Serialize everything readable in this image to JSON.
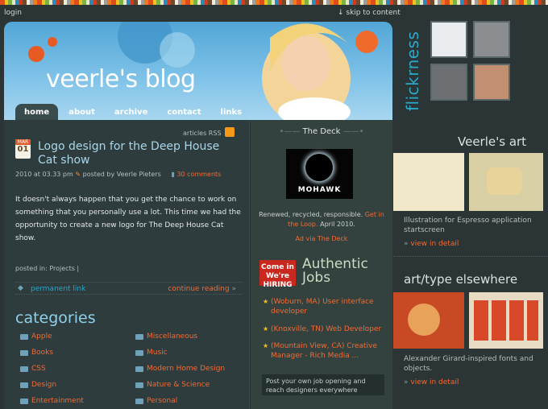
{
  "top": {
    "login": "login",
    "skip": "skip to content"
  },
  "header": {
    "title": "veerle's blog",
    "nav": [
      {
        "label": "home",
        "active": true
      },
      {
        "label": "about",
        "active": false
      },
      {
        "label": "archive",
        "active": false
      },
      {
        "label": "contact",
        "active": false
      },
      {
        "label": "links",
        "active": false
      }
    ]
  },
  "post": {
    "rss_label": "articles RSS",
    "date_month": "MAR",
    "date_day": "01",
    "title": "Logo design for the Deep House Cat show",
    "meta_date": "2010 at 03.33 pm",
    "meta_author": "posted by Veerle Pieters",
    "comments": "30 comments",
    "body": "It doesn't always happen that you get the chance to work on something that you personally use a lot. This time we had the opportunity to create a new logo for The Deep House Cat show.",
    "posted_in": "posted in: Projects |",
    "permanent_link": "permanent link",
    "continue_reading": "continue reading"
  },
  "categories": {
    "title": "categories",
    "left": [
      "Apple",
      "Books",
      "CSS",
      "Design",
      "Entertainment"
    ],
    "right": [
      "Miscellaneous",
      "Music",
      "Modern Home Design",
      "Nature & Science",
      "Personal"
    ]
  },
  "deck": {
    "title": "The Deck",
    "ad_word": "MOHAWK",
    "desc_text": "Renewed, recycled, responsible.",
    "desc_link": "Get in the Loop.",
    "desc_date": "April 2010.",
    "ad_via": "Ad via The Deck"
  },
  "jobs": {
    "badge_line1": "Come in",
    "badge_line2": "We're",
    "badge_line3": "HIRING",
    "title_line1": "Authentic",
    "title_line2": "Jobs",
    "items": [
      "(Woburn, MA) User interface developer",
      "(Knoxville, TN) Web Developer",
      "(Mountain View, CA) Creative Manager - Rich Media ..."
    ],
    "post_box": "Post your own job opening and reach designers everywhere"
  },
  "right": {
    "flickr_label": "flickrness",
    "veerles_art": "Veerle's art",
    "art_caption": "Illustration for Espresso application startscreen",
    "view_detail_1": "view in detail",
    "art_elsewhere": "art/type elsewhere",
    "elsewhere_caption": "Alexander Girard-inspired fonts and objects.",
    "view_detail_2": "view in detail"
  },
  "colors": {
    "background": "#2b3536",
    "accent_orange": "#f26a34",
    "accent_blue": "#2aa7c9",
    "header_sky": "#7dc1e8"
  }
}
